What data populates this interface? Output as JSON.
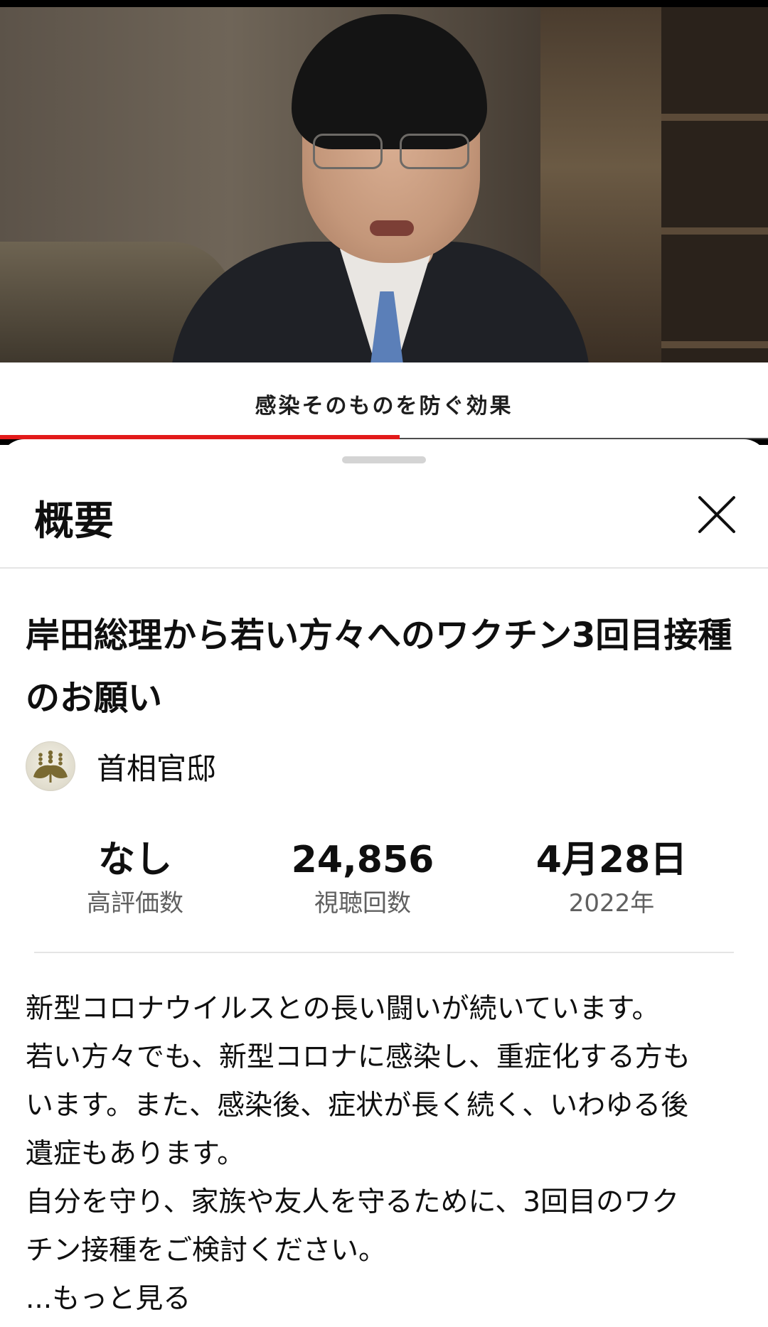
{
  "player": {
    "caption": "感染そのものを防ぐ効果",
    "progress_fraction": 0.52
  },
  "sheet": {
    "title": "概要",
    "close_icon": "close-icon"
  },
  "video": {
    "title": "岸田総理から若い方々へのワクチン3回目接種のお願い",
    "channel_name": "首相官邸",
    "channel_avatar_icon": "paulownia-crest"
  },
  "stats": [
    {
      "value": "なし",
      "label": "高評価数"
    },
    {
      "value": "24,856",
      "label": "視聴回数"
    },
    {
      "value": "4月28日",
      "label": "2022年"
    }
  ],
  "description": {
    "lines": [
      "新型コロナウイルスとの長い闘いが続いています。",
      "若い方々でも、新型コロナに感染し、重症化する方も",
      "います。また、感染後、症状が長く続く、いわゆる後",
      "遺症もあります。",
      "自分を守り、家族や友人を守るために、3回目のワク",
      "チン接種をご検討ください。"
    ],
    "more_label": "...もっと見る"
  },
  "colors": {
    "progress": "#e21a1a",
    "text_primary": "#0f0f0f",
    "text_secondary": "#606060",
    "divider": "#e5e5e5"
  }
}
